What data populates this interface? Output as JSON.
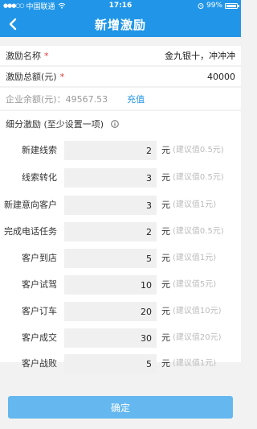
{
  "status_bar": {
    "signal": "●●●○○",
    "carrier": "中国联通",
    "wifi_icon": "wifi-icon",
    "time": "17:16",
    "battery": "99%",
    "battery_level": 0.99
  },
  "nav": {
    "title": "新增激励",
    "back_icon": "chevron-left-icon"
  },
  "form": {
    "name_label": "激励名称",
    "name_value": "金九银十，冲冲冲",
    "total_label": "激励总额(元)",
    "total_value": "40000",
    "required_mark": "*",
    "balance_text": "企业余额(元)：49567.53",
    "recharge_label": "充值"
  },
  "section": {
    "title": "细分激励 (至少设置一项)",
    "info_icon": "info-icon",
    "unit": "元",
    "items": [
      {
        "label": "新建线索",
        "value": "2",
        "hint": "(建议值0.5元)"
      },
      {
        "label": "线索转化",
        "value": "3",
        "hint": "(建议值0.5元)"
      },
      {
        "label": "新建意向客户",
        "value": "3",
        "hint": "(建议值1元)"
      },
      {
        "label": "完成电话任务",
        "value": "2",
        "hint": "(建议值0.5元)"
      },
      {
        "label": "客户到店",
        "value": "5",
        "hint": "(建议值1元)"
      },
      {
        "label": "客户试驾",
        "value": "10",
        "hint": "(建议值5元)"
      },
      {
        "label": "客户订车",
        "value": "20",
        "hint": "(建议值10元)"
      },
      {
        "label": "客户成交",
        "value": "30",
        "hint": "(建议值20元)"
      },
      {
        "label": "客户战败",
        "value": "5",
        "hint": "(建议值1元)"
      }
    ]
  },
  "confirm_label": "确定",
  "colors": {
    "primary": "#2196e8",
    "button": "#64b7ef",
    "required": "#e53935"
  }
}
